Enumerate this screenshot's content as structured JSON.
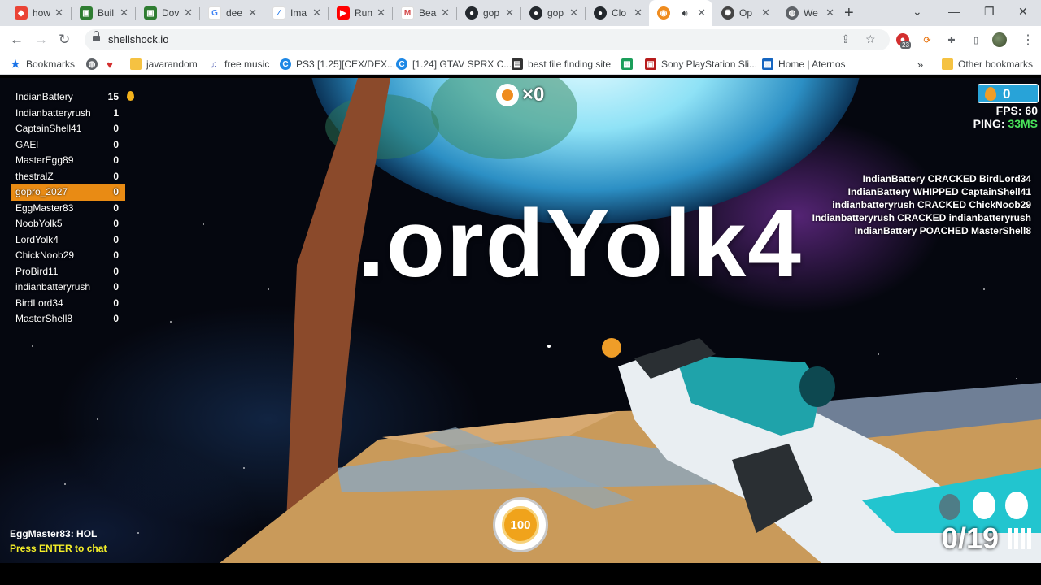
{
  "tabs": [
    {
      "label": "how",
      "icon": "multicolor-app-icon",
      "color": "#ea4335"
    },
    {
      "label": "Buil",
      "icon": "green-app-icon",
      "color": "#2f7d32"
    },
    {
      "label": "Dov",
      "icon": "green-app-icon",
      "color": "#2f7d32"
    },
    {
      "label": "dee",
      "icon": "google-icon",
      "color": "#4285f4"
    },
    {
      "label": "Ima",
      "icon": "chart-icon",
      "color": "#1a73e8"
    },
    {
      "label": "Run",
      "icon": "youtube-icon",
      "color": "#ff0000"
    },
    {
      "label": "Bea",
      "icon": "medium-icon",
      "color": "#d13f3f"
    },
    {
      "label": "gop",
      "icon": "github-icon",
      "color": "#24292e"
    },
    {
      "label": "gop",
      "icon": "github-icon",
      "color": "#24292e"
    },
    {
      "label": "Clo",
      "icon": "github-icon",
      "color": "#24292e"
    },
    {
      "label": "",
      "icon": "shellshock-icon",
      "color": "#ef8c1f",
      "active": true
    },
    {
      "label": "Op",
      "icon": "openai-icon",
      "color": "#444444"
    },
    {
      "label": "We",
      "icon": "globe-icon",
      "color": "#5f6368"
    }
  ],
  "address": {
    "url": "shellshock.io"
  },
  "bookmarks": [
    {
      "label": "Bookmarks",
      "icon": "star-icon"
    },
    {
      "label": "",
      "icon": "globe-icon"
    },
    {
      "label": "",
      "icon": "heart-icon"
    },
    {
      "label": "javarandom",
      "icon": "folder-icon"
    },
    {
      "label": "free music",
      "icon": "music-icon"
    },
    {
      "label": "PS3 [1.25][CEX/DEX...",
      "icon": "c-icon"
    },
    {
      "label": "[1.24] GTAV SPRX C...",
      "icon": "c-icon"
    },
    {
      "label": "best file finding site",
      "icon": "box-icon"
    },
    {
      "label": "",
      "icon": "green-square-icon"
    },
    {
      "label": "Sony PlayStation Sli...",
      "icon": "gift-icon"
    },
    {
      "label": "Home | Aternos",
      "icon": "aternos-icon"
    },
    {
      "label": "Other bookmarks",
      "icon": "folder-icon"
    }
  ],
  "extensions": {
    "badge": "23"
  },
  "game": {
    "leaderboard": [
      {
        "name": "IndianBattery",
        "score": "15"
      },
      {
        "name": "Indianbatteryrush",
        "score": "1"
      },
      {
        "name": "CaptainShell41",
        "score": "0"
      },
      {
        "name": "GAEl",
        "score": "0"
      },
      {
        "name": "MasterEgg89",
        "score": "0"
      },
      {
        "name": "thestralZ",
        "score": "0"
      },
      {
        "name": "gopro_2027",
        "score": "0",
        "me": true
      },
      {
        "name": "EggMaster83",
        "score": "0"
      },
      {
        "name": "NoobYolk5",
        "score": "0"
      },
      {
        "name": "LordYolk4",
        "score": "0"
      },
      {
        "name": "ChickNoob29",
        "score": "0"
      },
      {
        "name": "ProBird11",
        "score": "0"
      },
      {
        "name": "indianbatteryrush",
        "score": "0"
      },
      {
        "name": "BirdLord34",
        "score": "0"
      },
      {
        "name": "MasterShell8",
        "score": "0"
      }
    ],
    "kill_counter": "×0",
    "egg_count": "0",
    "fps": "FPS: 60",
    "ping_label": "PING:",
    "ping_value": "33MS",
    "killfeed": [
      "IndianBattery CRACKED BirdLord34",
      "IndianBattery WHIPPED CaptainShell41",
      "indianbatteryrush CRACKED ChickNoob29",
      "Indianbatteryrush CRACKED indianbatteryrush",
      "IndianBattery POACHED MasterShell8"
    ],
    "banner": ".ordYolk4",
    "health": "100",
    "ammo": "0/19",
    "chat_message": "EggMaster83: HOL",
    "chat_hint": "Press ENTER to chat",
    "colors": {
      "me_highlight": "#e98b14",
      "ping": "#4ae35b",
      "chat_hint": "#f6f028",
      "egg_counter_bg": "#28a3d8"
    }
  }
}
